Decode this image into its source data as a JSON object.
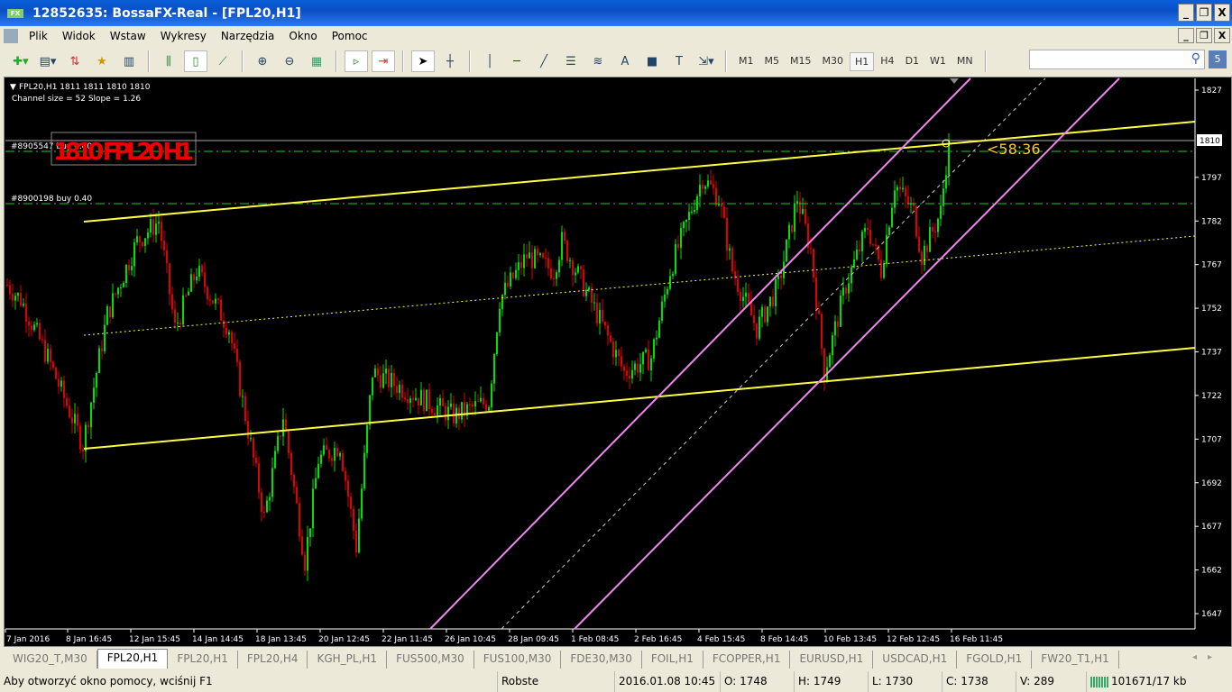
{
  "window": {
    "title": "12852635: BossaFX-Real - [FPL20,H1]",
    "logo": "FX"
  },
  "menu": [
    "Plik",
    "Widok",
    "Wstaw",
    "Wykresy",
    "Narzędzia",
    "Okno",
    "Pomoc"
  ],
  "timeframes": [
    "M1",
    "M5",
    "M15",
    "M30",
    "H1",
    "H4",
    "D1",
    "W1",
    "MN"
  ],
  "active_timeframe": "H1",
  "search": {
    "value": "",
    "badge": "5"
  },
  "chart": {
    "header": "FPL20,H1  1811 1811 1810 1810",
    "indicator": "Channel size = 52 Slope = 1.26",
    "order1": "#8905547 buy 0.40",
    "order2": "#8900198 buy 0.40",
    "big_label": "1810 FPL20 H1",
    "countdown": "<58:36",
    "current_price": "1810",
    "colors": {
      "bull": "#00e000",
      "bear": "#e00000",
      "channel": "#ffff40",
      "magenta": "#ee88ee"
    }
  },
  "chart_data": {
    "type": "candlestick",
    "symbol": "FPL20",
    "timeframe": "H1",
    "ylim": [
      1642,
      1832
    ],
    "price_ticks": [
      1827,
      1797,
      1782,
      1767,
      1752,
      1737,
      1722,
      1707,
      1692,
      1677,
      1662,
      1647
    ],
    "time_ticks": [
      "7 Jan 2016",
      "8 Jan 16:45",
      "12 Jan 15:45",
      "14 Jan 14:45",
      "18 Jan 13:45",
      "20 Jan 12:45",
      "22 Jan 11:45",
      "26 Jan 10:45",
      "28 Jan 09:45",
      "1 Feb 08:45",
      "2 Feb 16:45",
      "4 Feb 15:45",
      "8 Feb 14:45",
      "10 Feb 13:45",
      "12 Feb 12:45",
      "16 Feb 11:45"
    ],
    "close_waypoints": [
      [
        0,
        1760
      ],
      [
        5,
        1755
      ],
      [
        15,
        1735
      ],
      [
        28,
        1705
      ],
      [
        37,
        1750
      ],
      [
        48,
        1775
      ],
      [
        56,
        1782
      ],
      [
        62,
        1745
      ],
      [
        70,
        1765
      ],
      [
        82,
        1745
      ],
      [
        87,
        1720
      ],
      [
        95,
        1680
      ],
      [
        102,
        1715
      ],
      [
        110,
        1665
      ],
      [
        115,
        1700
      ],
      [
        123,
        1705
      ],
      [
        129,
        1670
      ],
      [
        135,
        1730
      ],
      [
        145,
        1725
      ],
      [
        155,
        1720
      ],
      [
        165,
        1715
      ],
      [
        178,
        1720
      ],
      [
        182,
        1755
      ],
      [
        192,
        1770
      ],
      [
        202,
        1765
      ],
      [
        205,
        1775
      ],
      [
        218,
        1750
      ],
      [
        228,
        1730
      ],
      [
        238,
        1735
      ],
      [
        245,
        1765
      ],
      [
        257,
        1797
      ],
      [
        263,
        1790
      ],
      [
        268,
        1765
      ],
      [
        277,
        1745
      ],
      [
        285,
        1760
      ],
      [
        292,
        1790
      ],
      [
        297,
        1772
      ],
      [
        302,
        1730
      ],
      [
        310,
        1760
      ],
      [
        318,
        1780
      ],
      [
        323,
        1765
      ],
      [
        328,
        1795
      ],
      [
        335,
        1785
      ],
      [
        338,
        1770
      ],
      [
        345,
        1785
      ],
      [
        348,
        1810
      ]
    ]
  },
  "tabs": [
    "WIG20_T,M30",
    "FPL20,H1",
    "FPL20,H1",
    "FPL20,H4",
    "KGH_PL,H1",
    "FUS500,M30",
    "FUS100,M30",
    "FDE30,M30",
    "FOIL,H1",
    "FCOPPER,H1",
    "EURUSD,H1",
    "USDCAD,H1",
    "FGOLD,H1",
    "FW20_T1,H1"
  ],
  "active_tab": 1,
  "status": {
    "help": "Aby otworzyć okno pomocy, wciśnij F1",
    "profile": "Robste",
    "datetime": "2016.01.08 10:45",
    "open": "O: 1748",
    "high": "H: 1749",
    "low": "L: 1730",
    "close": "C: 1738",
    "volume": "V: 289",
    "traffic": "101671/17 kb"
  }
}
